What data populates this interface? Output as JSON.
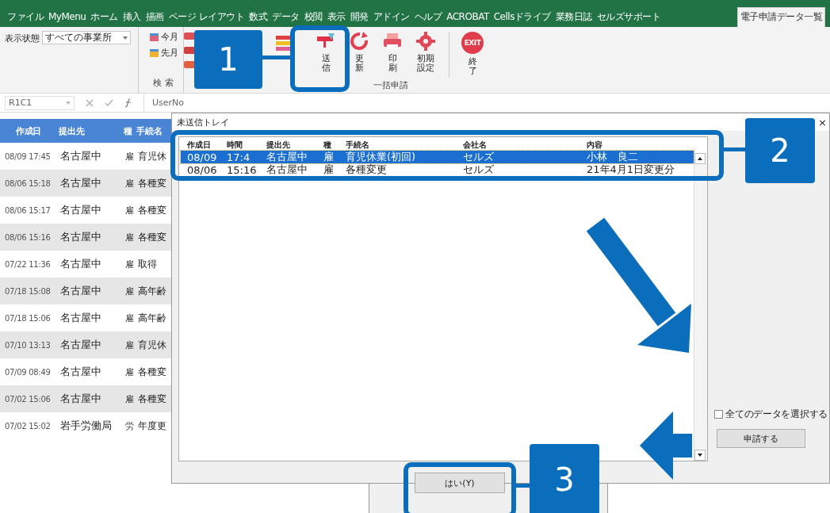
{
  "ribbon_tabs": [
    {
      "label": "ファイル",
      "selected": false
    },
    {
      "label": "MyMenu",
      "selected": false
    },
    {
      "label": "ホーム",
      "selected": false
    },
    {
      "label": "挿入",
      "selected": false
    },
    {
      "label": "描画",
      "selected": false
    },
    {
      "label": "ページ レイアウト",
      "selected": false
    },
    {
      "label": "数式",
      "selected": false
    },
    {
      "label": "データ",
      "selected": false
    },
    {
      "label": "校閲",
      "selected": false
    },
    {
      "label": "表示",
      "selected": false
    },
    {
      "label": "開発",
      "selected": false
    },
    {
      "label": "アドイン",
      "selected": false
    },
    {
      "label": "ヘルプ",
      "selected": false
    },
    {
      "label": "ACROBAT",
      "selected": false
    },
    {
      "label": "Cellsドライブ",
      "selected": false
    },
    {
      "label": "業務日誌",
      "selected": false
    },
    {
      "label": "セルズサポート",
      "selected": false
    },
    {
      "label": "電子申請データ一覧",
      "selected": true
    }
  ],
  "ribbon": {
    "display_label": "表示状態",
    "display_select": "すべての事業所",
    "search_buttons": [
      {
        "label": "今月"
      },
      {
        "label": "先月"
      }
    ],
    "search_group": "検 索",
    "action_buttons": [
      {
        "label": "送信"
      },
      {
        "label": "更新"
      },
      {
        "label": "印刷"
      },
      {
        "label": "初期設定"
      },
      {
        "label": "終了",
        "badge": "EXIT"
      }
    ],
    "action_group": "一括申請"
  },
  "formula_bar": {
    "name_box": "R1C1",
    "content": "UserNo"
  },
  "sheet": {
    "columns": [
      "作成日",
      "提出先",
      "種",
      "手続名"
    ],
    "rows": [
      [
        "08/09 17:45",
        "名古屋中",
        "雇",
        "育児休"
      ],
      [
        "08/06 15:18",
        "名古屋中",
        "雇",
        "各種変"
      ],
      [
        "08/06 15:17",
        "名古屋中",
        "雇",
        "各種変"
      ],
      [
        "08/06 15:16",
        "名古屋中",
        "雇",
        "各種変"
      ],
      [
        "07/22 11:36",
        "名古屋中",
        "雇",
        "取得"
      ],
      [
        "07/18 15:08",
        "名古屋中",
        "雇",
        "高年齢"
      ],
      [
        "07/18 15:06",
        "名古屋中",
        "雇",
        "高年齢"
      ],
      [
        "07/10 13:13",
        "名古屋中",
        "雇",
        "育児休"
      ],
      [
        "07/09 08:49",
        "名古屋中",
        "雇",
        "各種変"
      ],
      [
        "07/02 15:06",
        "名古屋中",
        "雇",
        "各種変"
      ],
      [
        "07/02 15:02",
        "岩手労働局",
        "労",
        "年度更"
      ]
    ]
  },
  "dialog": {
    "title": "未送信トレイ",
    "close": "×",
    "list": {
      "columns": [
        "作成日",
        "時間",
        "提出先",
        "種",
        "手続名",
        "会社名",
        "内容"
      ],
      "rows": [
        {
          "cells": [
            "08/09",
            "17:4",
            "名古屋中",
            "雇",
            "育児休業(初回)",
            "セルズ",
            "小林　良二"
          ],
          "selected": true
        },
        {
          "cells": [
            "08/06",
            "15:16",
            "名古屋中",
            "雇",
            "各種変更",
            "セルズ",
            "21年4月1日変更分"
          ],
          "selected": false
        }
      ]
    },
    "select_all": {
      "label": "全てのデータを選択する",
      "checked": false
    },
    "apply_button": "申請する"
  },
  "message_box": {
    "yes_button": "はい(Y)"
  },
  "callouts": [
    {
      "number": "1"
    },
    {
      "number": "2"
    },
    {
      "number": "3"
    }
  ]
}
